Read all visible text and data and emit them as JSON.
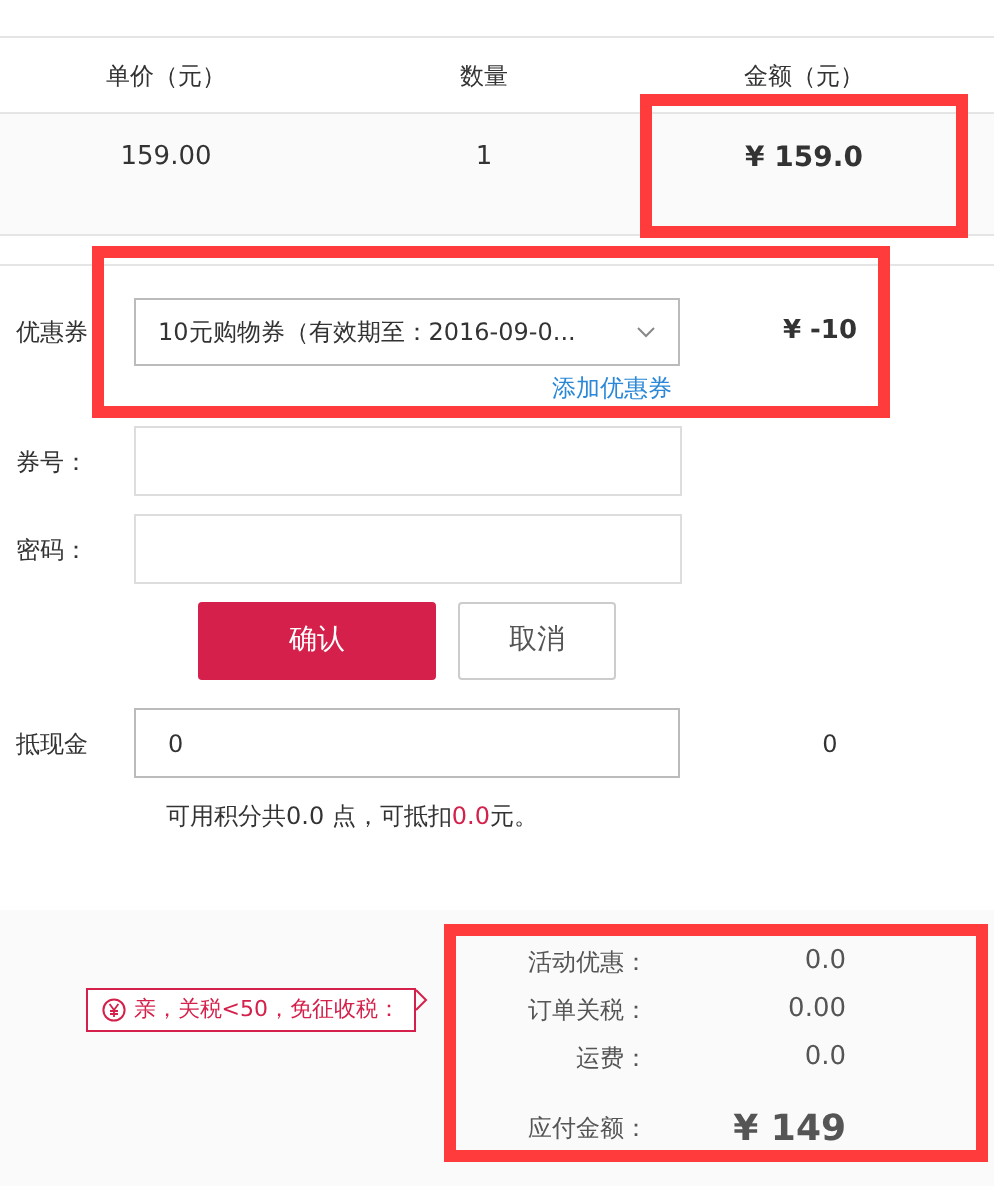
{
  "table": {
    "columns": [
      "单价（元）",
      "数量",
      "金额（元）"
    ],
    "rows": [
      [
        "159.00",
        "1",
        "¥ 159.0"
      ]
    ]
  },
  "coupon": {
    "label": "优惠券",
    "selected_value": "10元购物券（有效期至：2016-09-0...",
    "amount": "¥ -10",
    "add_link": "添加优惠券"
  },
  "code_fields": [
    {
      "label": "券号："
    },
    {
      "label": "密码："
    }
  ],
  "buttons": [
    {
      "label": "确认",
      "kind": "primary"
    },
    {
      "label": "取消",
      "kind": "secondary"
    }
  ],
  "points": {
    "label": "抵现金",
    "value": "0",
    "amount": "0",
    "hint_before": "可用积分共0.0 点，可抵扣",
    "hint_amount": "0.0",
    "hint_after": "元。"
  },
  "summary": {
    "tip": "亲，关税<50，免征收税：",
    "rows": [
      {
        "label": "活动优惠：",
        "value": "0.0",
        "kind": "line"
      },
      {
        "label": "订单关税：",
        "value": "0.00",
        "kind": "line"
      },
      {
        "label": "运费：",
        "value": "0.0",
        "kind": "line"
      },
      {
        "label": "应付金额：",
        "value": "¥ 149",
        "kind": "total"
      }
    ]
  },
  "annotations": [
    {
      "kind": "highlight",
      "color": "#ff3b3b"
    },
    {
      "kind": "highlight",
      "color": "#ff3b3b"
    },
    {
      "kind": "highlight",
      "color": "#ff3b3b"
    }
  ]
}
